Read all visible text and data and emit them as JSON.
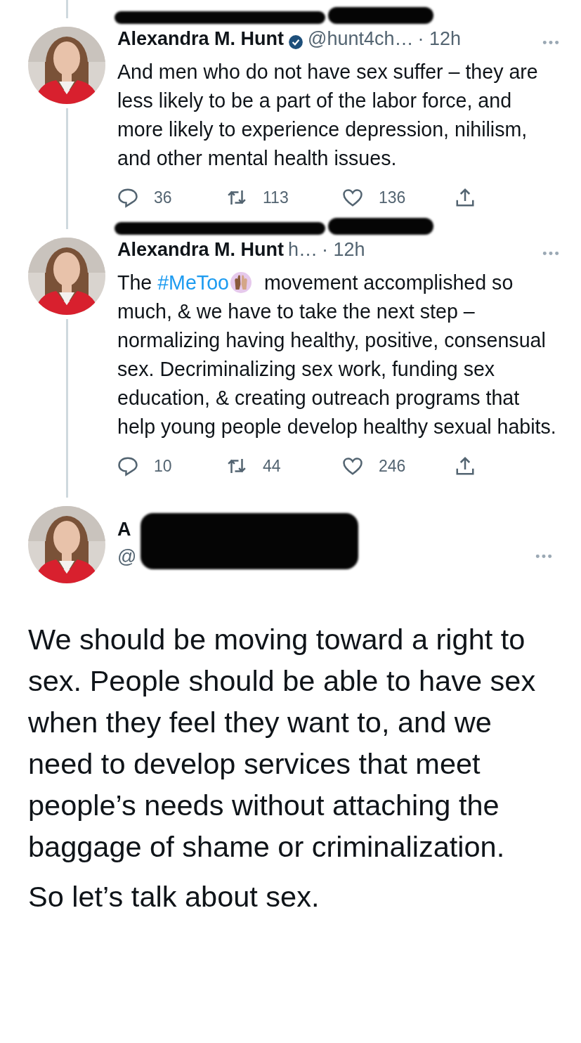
{
  "thread": [
    {
      "name": "Alexandra M. Hunt",
      "verified": true,
      "handle": "@hunt4ch…",
      "time": "· 12h",
      "parts": [
        {
          "kind": "text",
          "text": "And men who do not have sex suffer – they are less likely to be a part of the labor force, and more likely to experience depression, nihilism, and other mental health issues."
        }
      ],
      "actions": [
        {
          "kind": "reply",
          "count": "36"
        },
        {
          "kind": "retweet",
          "count": "113"
        },
        {
          "kind": "like",
          "count": "136"
        },
        {
          "kind": "share"
        }
      ]
    },
    {
      "name": "Alexandra M. Hunt",
      "handle": "h…",
      "time": "· 12h",
      "parts": [
        {
          "kind": "text",
          "text": "The "
        },
        {
          "kind": "hashtag",
          "text": "#MeToo"
        },
        {
          "kind": "emoji"
        },
        {
          "kind": "text",
          "text": " movement accomplished so much, & we have to take the next step – normalizing having healthy, positive, consensual sex. Decriminalizing sex work, funding sex education, & creating outreach programs that help young people develop healthy sexual habits."
        }
      ],
      "actions": [
        {
          "kind": "reply",
          "count": "10"
        },
        {
          "kind": "retweet",
          "count": "44"
        },
        {
          "kind": "like",
          "count": "246"
        },
        {
          "kind": "share"
        }
      ]
    }
  ],
  "main": {
    "name": "A",
    "handle": "@",
    "paragraphs": [
      "We should be moving toward a right to sex. People should be able to have sex when they feel they want to, and we need to develop services that meet people’s needs without attaching the baggage of shame or criminalization.",
      "So let’s talk about sex."
    ]
  }
}
